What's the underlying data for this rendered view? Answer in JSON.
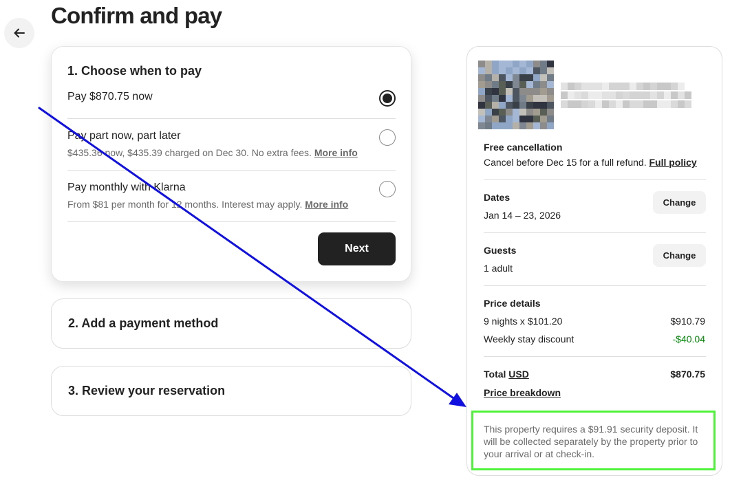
{
  "page": {
    "title": "Confirm and pay"
  },
  "step1": {
    "heading": "1. Choose when to pay",
    "options": [
      {
        "label": "Pay $870.75 now",
        "sub": "",
        "link": "",
        "checked": true
      },
      {
        "label": "Pay part now, part later",
        "sub": "$435.36 now, $435.39 charged on Dec 30. No extra fees.",
        "link": "More info",
        "checked": false
      },
      {
        "label": "Pay monthly with Klarna",
        "sub": "From $81 per month for 12 months. Interest may apply.",
        "link": "More info",
        "checked": false
      }
    ],
    "next_label": "Next"
  },
  "step2": {
    "heading": "2. Add a payment method"
  },
  "step3": {
    "heading": "3. Review your reservation"
  },
  "summary": {
    "cancellation": {
      "title": "Free cancellation",
      "text": "Cancel before Dec 15 for a full refund.",
      "link": "Full policy"
    },
    "dates": {
      "label": "Dates",
      "value": "Jan 14 – 23, 2026",
      "change": "Change"
    },
    "guests": {
      "label": "Guests",
      "value": "1 adult",
      "change": "Change"
    },
    "price": {
      "title": "Price details",
      "rows": [
        {
          "label": "9 nights x $101.20",
          "amount": "$910.79"
        },
        {
          "label": "Weekly stay discount",
          "amount": "-$40.04"
        }
      ],
      "total_label": "Total",
      "currency": "USD",
      "total": "$870.75",
      "breakdown_link": "Price breakdown"
    },
    "deposit_notice": "This property requires a $91.91 security deposit. It will be collected separately by the property prior to your arrival or at check-in."
  },
  "colors": {
    "accent_dark": "#222222",
    "discount_green": "#008a05",
    "annotation_arrow": "#1010e0",
    "annotation_highlight": "#4ef33a"
  },
  "icons": {
    "back": "arrow-left-icon"
  }
}
